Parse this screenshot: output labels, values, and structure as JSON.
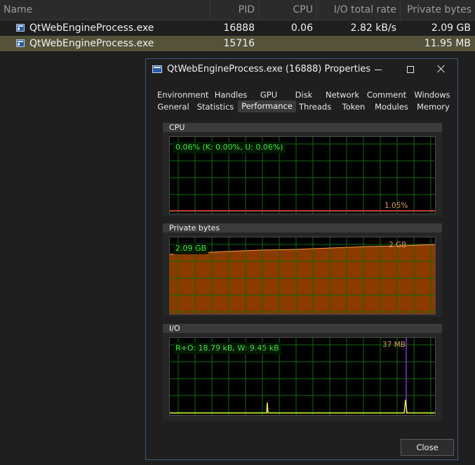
{
  "list": {
    "columns": [
      "Name",
      "PID",
      "CPU",
      "I/O total rate",
      "Private bytes"
    ],
    "rows": [
      {
        "name": "QtWebEngineProcess.exe",
        "pid": "16888",
        "cpu": "0.06",
        "io": "2.82 kB/s",
        "private": "2.09 GB"
      },
      {
        "name": "QtWebEngineProcess.exe",
        "pid": "15716",
        "cpu": "",
        "io": "",
        "private": "11.95 MB"
      }
    ],
    "selected_row_color": "#54533a",
    "icon": "process-window-icon"
  },
  "dialog": {
    "title": "QtWebEngineProcess.exe (16888) Properties",
    "tabs_row1": [
      "Environment",
      "Handles",
      "GPU",
      "Disk",
      "Network",
      "Comment",
      "Windows"
    ],
    "tabs_row2": [
      "General",
      "Statistics",
      "Performance",
      "Threads",
      "Token",
      "Modules",
      "Memory"
    ],
    "active_tab": "Performance",
    "close_button": "Close",
    "panels": {
      "cpu": {
        "title": "CPU",
        "current": "0.06% (K: 0.00%, U: 0.06%)",
        "max_label": "1.05%"
      },
      "private_bytes": {
        "title": "Private bytes",
        "current": "2.09 GB",
        "max_label": "2 GB"
      },
      "io": {
        "title": "I/O",
        "current": "R+O: 18.79 kB, W: 9.45 kB",
        "max_label": "37 MB"
      }
    },
    "colors": {
      "grid": "#0e6b0e",
      "cpu_line": "#ff3030",
      "private_fill": "#8b3a00",
      "private_line": "#ff9a3a",
      "io_line": "#ffff40",
      "io_write": "#8a2be2",
      "label_text": "#3ee23e",
      "border_accent": "#3d5a80"
    }
  }
}
